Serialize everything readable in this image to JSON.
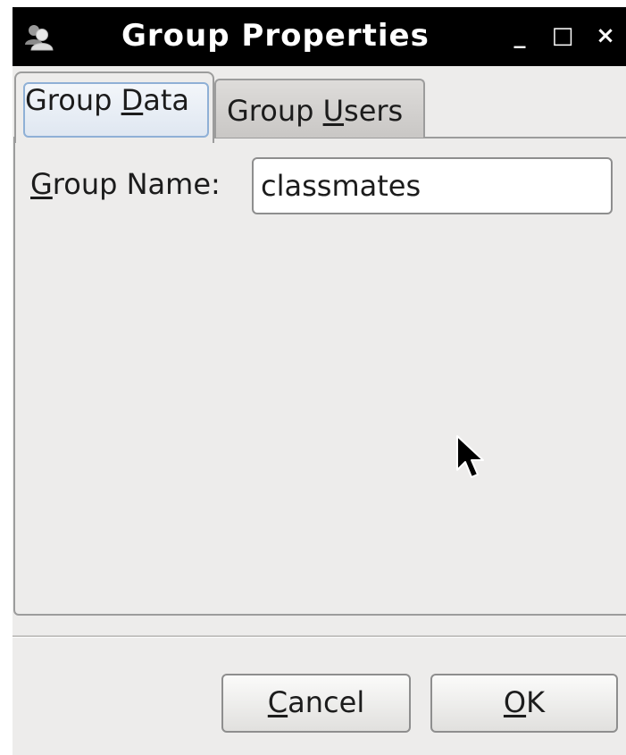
{
  "window": {
    "title": "Group Properties",
    "title_icon": "group-icon",
    "controls": {
      "minimize": "_",
      "maximize": "□",
      "close": "×"
    }
  },
  "tabs": [
    {
      "label_prefix": "Group ",
      "mnemonic": "D",
      "label_suffix": "ata",
      "active": true
    },
    {
      "label_prefix": "Group ",
      "mnemonic": "U",
      "label_suffix": "sers",
      "active": false
    }
  ],
  "form": {
    "group_name_mnemonic": "G",
    "group_name_label_rest": "roup Name:",
    "group_name_value": "classmates"
  },
  "buttons": {
    "cancel_mnemonic": "C",
    "cancel_rest": "ancel",
    "ok_mnemonic": "O",
    "ok_rest": "K"
  },
  "colors": {
    "titlebar": "#000000",
    "window_bg": "#edeceb",
    "active_tab_highlight": "#8fb0d6"
  }
}
